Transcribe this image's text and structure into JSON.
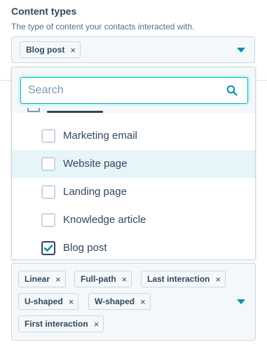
{
  "header": {
    "title": "Content types",
    "subtitle": "The type of content your contacts interacted with."
  },
  "content_types_select": {
    "chips": [
      {
        "label": "Blog post",
        "remove": "×"
      }
    ]
  },
  "dropdown": {
    "search_placeholder": "Search",
    "search_value": "",
    "options": [
      {
        "label": "Marketing email",
        "checked": false,
        "highlighted": false
      },
      {
        "label": "Website page",
        "checked": false,
        "highlighted": true
      },
      {
        "label": "Landing page",
        "checked": false,
        "highlighted": false
      },
      {
        "label": "Knowledge article",
        "checked": false,
        "highlighted": false
      },
      {
        "label": "Blog post",
        "checked": true,
        "highlighted": false
      }
    ]
  },
  "attribution_select": {
    "chips": [
      {
        "label": "Linear",
        "remove": "×"
      },
      {
        "label": "Full-path",
        "remove": "×"
      },
      {
        "label": "Last interaction",
        "remove": "×"
      },
      {
        "label": "U-shaped",
        "remove": "×"
      },
      {
        "label": "W-shaped",
        "remove": "×"
      },
      {
        "label": "First interaction",
        "remove": "×"
      }
    ]
  },
  "colors": {
    "accent": "#0091ae",
    "focus_ring": "#00bda5",
    "highlight_row": "#e5f5f8",
    "text": "#33475b"
  },
  "icons": {
    "search": "search-icon",
    "caret": "caret-down-icon",
    "check": "check-icon",
    "remove": "close-icon"
  }
}
